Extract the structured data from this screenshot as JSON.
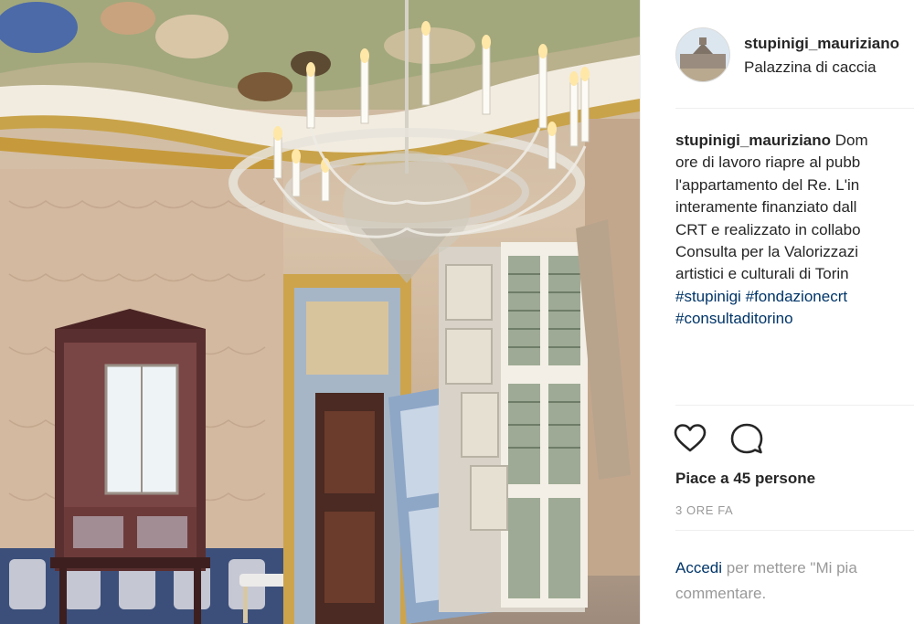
{
  "post": {
    "author": "stupinigi_mauriziano",
    "location": "Palazzina di caccia",
    "caption_lines": [
      "Dom",
      "ore di lavoro riapre al pubb",
      "l'appartamento del Re. L'in",
      "interamente finanziato dall",
      "CRT e realizzato in collabo",
      "Consulta per la Valorizzazi",
      "artistici e culturali di Torin"
    ],
    "hashtags": [
      "#stupinigi",
      "#fondazionecrt",
      "#consultaditorino"
    ],
    "likes": "Piace a 45 persone",
    "timestamp": "3 ORE FA",
    "login_link": "Accedi",
    "login_rest": " per mettere \"Mi pia",
    "login_line2": "commentare."
  },
  "icons": {
    "like": "heart-icon",
    "comment": "comment-icon"
  },
  "colors": {
    "link": "#003569",
    "text": "#262626",
    "muted": "#999999",
    "border": "#efefef"
  }
}
